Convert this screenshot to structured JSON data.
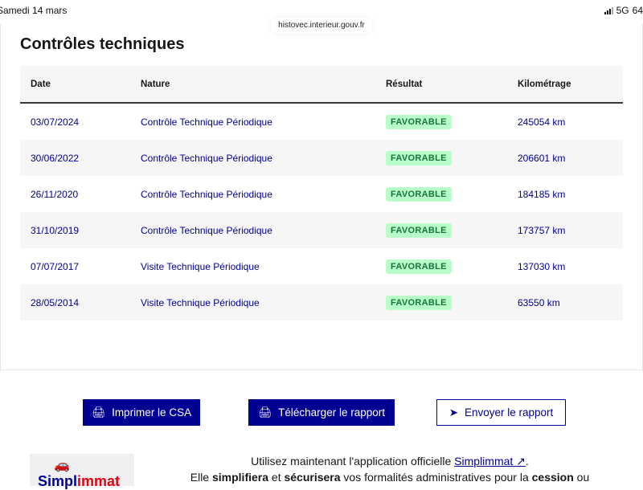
{
  "status_bar": {
    "date": "Samedi 14 mars",
    "network": "5G",
    "battery": "64"
  },
  "url": "histovec.interieur.gouv.fr",
  "title": "Contrôles techniques",
  "table": {
    "headers": [
      "Date",
      "Nature",
      "Résultat",
      "Kilométrage"
    ],
    "rows": [
      {
        "date": "03/07/2024",
        "nature": "Contrôle Technique Périodique",
        "result": "FAVORABLE",
        "km": "245054 km"
      },
      {
        "date": "30/06/2022",
        "nature": "Contrôle Technique Périodique",
        "result": "FAVORABLE",
        "km": "206601 km"
      },
      {
        "date": "26/11/2020",
        "nature": "Contrôle Technique Périodique",
        "result": "FAVORABLE",
        "km": "184185 km"
      },
      {
        "date": "31/10/2019",
        "nature": "Contrôle Technique Périodique",
        "result": "FAVORABLE",
        "km": "173757 km"
      },
      {
        "date": "07/07/2017",
        "nature": "Visite Technique Périodique",
        "result": "FAVORABLE",
        "km": "137030 km"
      },
      {
        "date": "28/05/2014",
        "nature": "Visite Technique Périodique",
        "result": "FAVORABLE",
        "km": "63550 km"
      }
    ]
  },
  "buttons": {
    "print": "Imprimer le CSA",
    "download": "Télécharger le rapport",
    "send": "Envoyer le rapport"
  },
  "promo": {
    "logo_a": "Simpl",
    "logo_b": "immat",
    "line1_pre": "Utilisez maintenant l'application officielle ",
    "link": "Simplimmat",
    "line1_post": ".",
    "l2_a": "Elle ",
    "l2_b": "simplifiera",
    "l2_c": " et ",
    "l2_d": "sécurisera",
    "l2_e": " vos formalités administratives pour la ",
    "l2_f": "cession",
    "l2_g": " ou"
  }
}
